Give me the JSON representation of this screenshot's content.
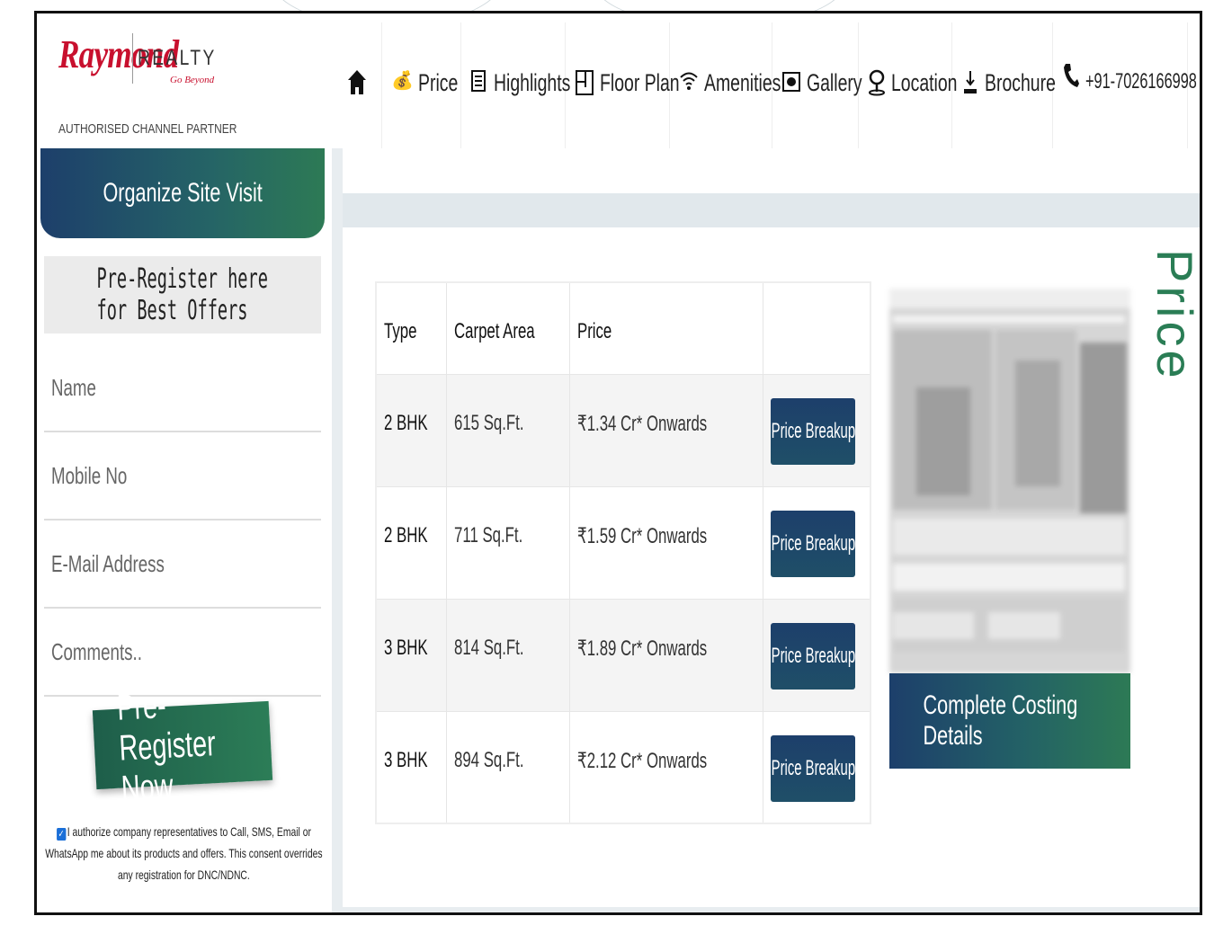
{
  "brand": {
    "name": "Raymond",
    "realty": "REALTY",
    "tagline": "Go Beyond",
    "partner_label": "AUTHORISED CHANNEL PARTNER"
  },
  "nav": {
    "items": [
      {
        "label": "",
        "icon": "home-icon"
      },
      {
        "label": "Price",
        "icon": "price-icon"
      },
      {
        "label": "Highlights",
        "icon": "highlights-icon"
      },
      {
        "label": "Floor Plan",
        "icon": "floor-plan-icon"
      },
      {
        "label": "Amenities",
        "icon": "amenities-icon"
      },
      {
        "label": "Gallery",
        "icon": "gallery-icon"
      },
      {
        "label": "Location",
        "icon": "location-icon"
      },
      {
        "label": "Brochure",
        "icon": "download-icon"
      },
      {
        "label": "+91-7026166998",
        "icon": "phone-icon"
      }
    ]
  },
  "sidebar": {
    "visit_label": "Organize Site Visit",
    "form_title": "Pre-Register here for Best Offers",
    "fields": {
      "name": "Name",
      "mobile": "Mobile No",
      "email": "E-Mail Address",
      "comments": "Comments.."
    },
    "submit_label": "Pre-Register Now",
    "consent_text": "I authorize company representatives to Call, SMS, Email or WhatsApp me about its products and offers. This consent overrides any registration for DNC/NDNC.",
    "consent_checked": true
  },
  "price_section": {
    "heading": "Price",
    "columns": [
      "Type",
      "Carpet Area",
      "Price",
      ""
    ],
    "rows": [
      {
        "type": "2 BHK",
        "area": "615 Sq.Ft.",
        "price": "₹1.34 Cr* Onwards",
        "button": "Price Breakup"
      },
      {
        "type": "2 BHK",
        "area": "711 Sq.Ft.",
        "price": "₹1.59 Cr* Onwards",
        "button": "Price Breakup"
      },
      {
        "type": "3 BHK",
        "area": "814 Sq.Ft.",
        "price": "₹1.89 Cr* Onwards",
        "button": "Price Breakup"
      },
      {
        "type": "3 BHK",
        "area": "894 Sq.Ft.",
        "price": "₹2.12 Cr* Onwards",
        "button": "Price Breakup"
      }
    ],
    "costing_button": "Complete Costing Details"
  },
  "colors": {
    "navy": "#1d3f6b",
    "green": "#2d7a55",
    "brand_red": "#c8102e"
  }
}
